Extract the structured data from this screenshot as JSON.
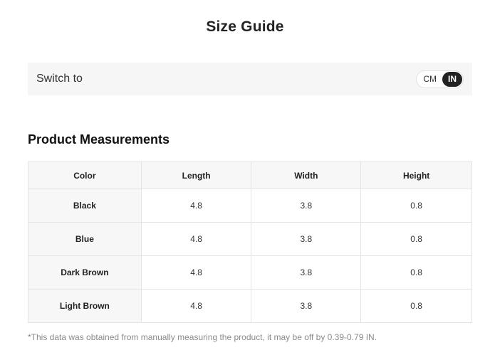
{
  "title": "Size Guide",
  "switch": {
    "label": "Switch to",
    "options": [
      "CM",
      "IN"
    ],
    "selected": "IN"
  },
  "section_title": "Product Measurements",
  "table": {
    "headers": [
      "Color",
      "Length",
      "Width",
      "Height"
    ],
    "rows": [
      [
        "Black",
        "4.8",
        "3.8",
        "0.8"
      ],
      [
        "Blue",
        "4.8",
        "3.8",
        "0.8"
      ],
      [
        "Dark Brown",
        "4.8",
        "3.8",
        "0.8"
      ],
      [
        "Light Brown",
        "4.8",
        "3.8",
        "0.8"
      ]
    ]
  },
  "footnote": "*This data was obtained from manually measuring the product, it may be off by 0.39-0.79 IN."
}
